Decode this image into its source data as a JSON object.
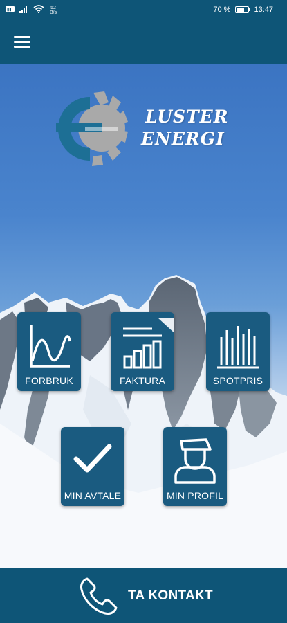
{
  "status_bar": {
    "speed": "52\nB/s",
    "battery_text": "70 %",
    "time": "13:47",
    "battery_level": 0.7
  },
  "brand": {
    "line1": "LUSTER",
    "line2": "ENERGI"
  },
  "tiles": {
    "forbruk": "FORBRUK",
    "faktura": "FAKTURA",
    "spotpris": "SPOTPRIS",
    "min_avtale": "MIN AVTALE",
    "min_profil": "MIN PROFIL"
  },
  "footer": {
    "contact_label": "TA KONTAKT"
  },
  "colors": {
    "primary": "#0e5577",
    "tile": "#1a5b80"
  },
  "icons": [
    "menu-icon",
    "chart-line-icon",
    "invoice-bar-icon",
    "spot-price-bars-icon",
    "checkmark-icon",
    "profile-icon",
    "phone-icon"
  ]
}
